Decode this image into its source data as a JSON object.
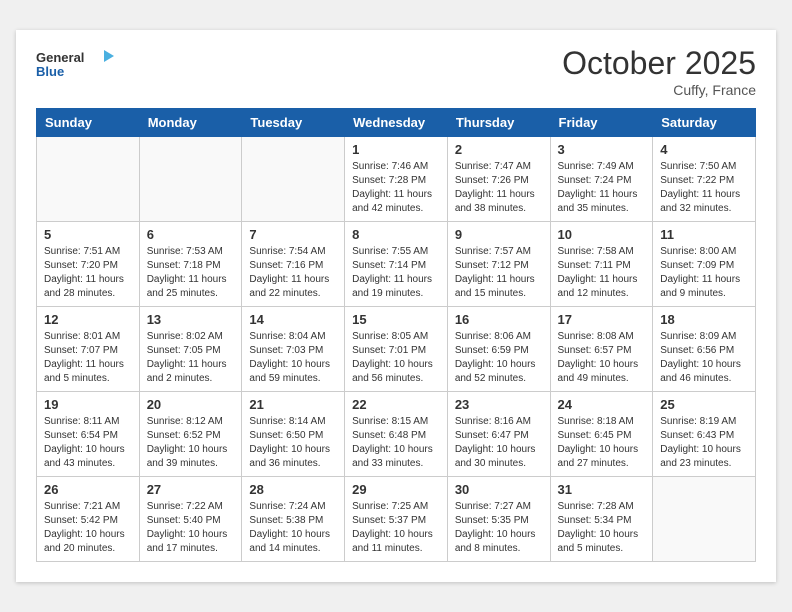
{
  "header": {
    "logo_line1": "General",
    "logo_line2": "Blue",
    "month": "October 2025",
    "location": "Cuffy, France"
  },
  "days_of_week": [
    "Sunday",
    "Monday",
    "Tuesday",
    "Wednesday",
    "Thursday",
    "Friday",
    "Saturday"
  ],
  "weeks": [
    [
      {
        "day": "",
        "info": ""
      },
      {
        "day": "",
        "info": ""
      },
      {
        "day": "",
        "info": ""
      },
      {
        "day": "1",
        "info": "Sunrise: 7:46 AM\nSunset: 7:28 PM\nDaylight: 11 hours and 42 minutes."
      },
      {
        "day": "2",
        "info": "Sunrise: 7:47 AM\nSunset: 7:26 PM\nDaylight: 11 hours and 38 minutes."
      },
      {
        "day": "3",
        "info": "Sunrise: 7:49 AM\nSunset: 7:24 PM\nDaylight: 11 hours and 35 minutes."
      },
      {
        "day": "4",
        "info": "Sunrise: 7:50 AM\nSunset: 7:22 PM\nDaylight: 11 hours and 32 minutes."
      }
    ],
    [
      {
        "day": "5",
        "info": "Sunrise: 7:51 AM\nSunset: 7:20 PM\nDaylight: 11 hours and 28 minutes."
      },
      {
        "day": "6",
        "info": "Sunrise: 7:53 AM\nSunset: 7:18 PM\nDaylight: 11 hours and 25 minutes."
      },
      {
        "day": "7",
        "info": "Sunrise: 7:54 AM\nSunset: 7:16 PM\nDaylight: 11 hours and 22 minutes."
      },
      {
        "day": "8",
        "info": "Sunrise: 7:55 AM\nSunset: 7:14 PM\nDaylight: 11 hours and 19 minutes."
      },
      {
        "day": "9",
        "info": "Sunrise: 7:57 AM\nSunset: 7:12 PM\nDaylight: 11 hours and 15 minutes."
      },
      {
        "day": "10",
        "info": "Sunrise: 7:58 AM\nSunset: 7:11 PM\nDaylight: 11 hours and 12 minutes."
      },
      {
        "day": "11",
        "info": "Sunrise: 8:00 AM\nSunset: 7:09 PM\nDaylight: 11 hours and 9 minutes."
      }
    ],
    [
      {
        "day": "12",
        "info": "Sunrise: 8:01 AM\nSunset: 7:07 PM\nDaylight: 11 hours and 5 minutes."
      },
      {
        "day": "13",
        "info": "Sunrise: 8:02 AM\nSunset: 7:05 PM\nDaylight: 11 hours and 2 minutes."
      },
      {
        "day": "14",
        "info": "Sunrise: 8:04 AM\nSunset: 7:03 PM\nDaylight: 10 hours and 59 minutes."
      },
      {
        "day": "15",
        "info": "Sunrise: 8:05 AM\nSunset: 7:01 PM\nDaylight: 10 hours and 56 minutes."
      },
      {
        "day": "16",
        "info": "Sunrise: 8:06 AM\nSunset: 6:59 PM\nDaylight: 10 hours and 52 minutes."
      },
      {
        "day": "17",
        "info": "Sunrise: 8:08 AM\nSunset: 6:57 PM\nDaylight: 10 hours and 49 minutes."
      },
      {
        "day": "18",
        "info": "Sunrise: 8:09 AM\nSunset: 6:56 PM\nDaylight: 10 hours and 46 minutes."
      }
    ],
    [
      {
        "day": "19",
        "info": "Sunrise: 8:11 AM\nSunset: 6:54 PM\nDaylight: 10 hours and 43 minutes."
      },
      {
        "day": "20",
        "info": "Sunrise: 8:12 AM\nSunset: 6:52 PM\nDaylight: 10 hours and 39 minutes."
      },
      {
        "day": "21",
        "info": "Sunrise: 8:14 AM\nSunset: 6:50 PM\nDaylight: 10 hours and 36 minutes."
      },
      {
        "day": "22",
        "info": "Sunrise: 8:15 AM\nSunset: 6:48 PM\nDaylight: 10 hours and 33 minutes."
      },
      {
        "day": "23",
        "info": "Sunrise: 8:16 AM\nSunset: 6:47 PM\nDaylight: 10 hours and 30 minutes."
      },
      {
        "day": "24",
        "info": "Sunrise: 8:18 AM\nSunset: 6:45 PM\nDaylight: 10 hours and 27 minutes."
      },
      {
        "day": "25",
        "info": "Sunrise: 8:19 AM\nSunset: 6:43 PM\nDaylight: 10 hours and 23 minutes."
      }
    ],
    [
      {
        "day": "26",
        "info": "Sunrise: 7:21 AM\nSunset: 5:42 PM\nDaylight: 10 hours and 20 minutes."
      },
      {
        "day": "27",
        "info": "Sunrise: 7:22 AM\nSunset: 5:40 PM\nDaylight: 10 hours and 17 minutes."
      },
      {
        "day": "28",
        "info": "Sunrise: 7:24 AM\nSunset: 5:38 PM\nDaylight: 10 hours and 14 minutes."
      },
      {
        "day": "29",
        "info": "Sunrise: 7:25 AM\nSunset: 5:37 PM\nDaylight: 10 hours and 11 minutes."
      },
      {
        "day": "30",
        "info": "Sunrise: 7:27 AM\nSunset: 5:35 PM\nDaylight: 10 hours and 8 minutes."
      },
      {
        "day": "31",
        "info": "Sunrise: 7:28 AM\nSunset: 5:34 PM\nDaylight: 10 hours and 5 minutes."
      },
      {
        "day": "",
        "info": ""
      }
    ]
  ]
}
